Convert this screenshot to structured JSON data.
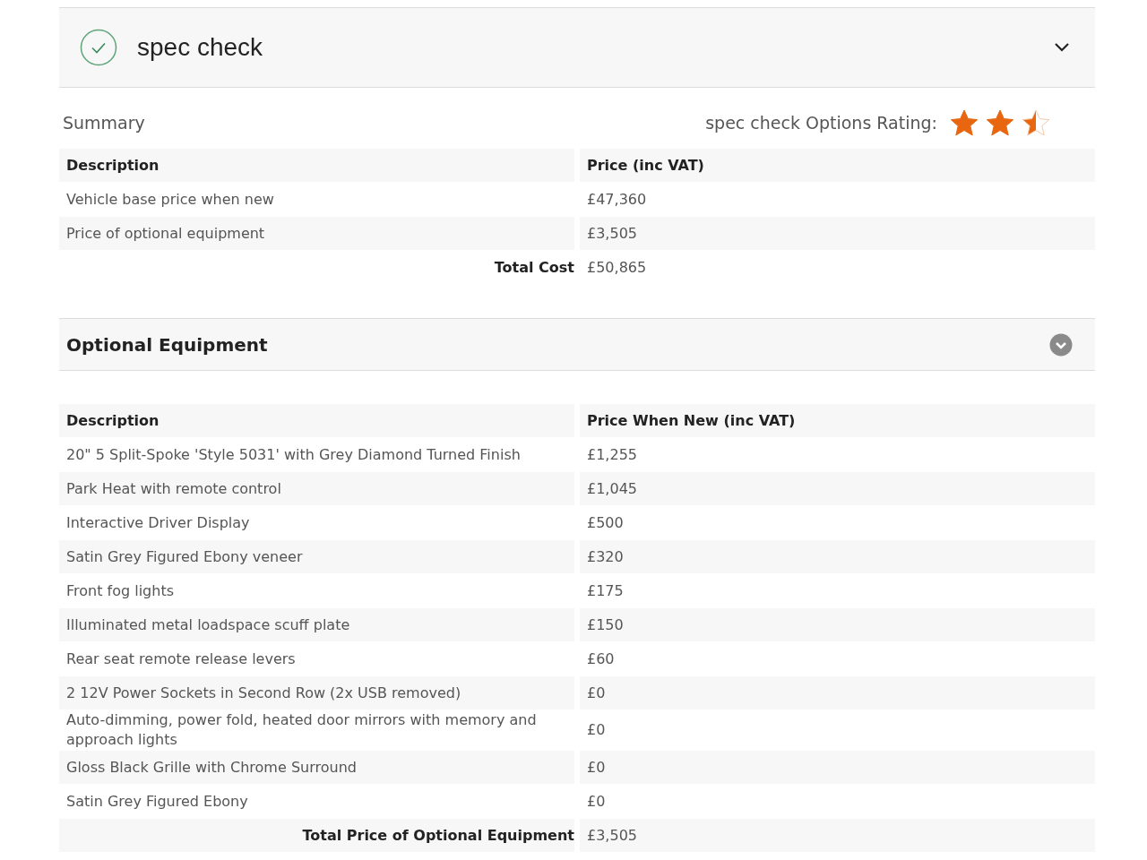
{
  "header": {
    "title": "spec check",
    "expanded": true
  },
  "summary": {
    "title": "Summary",
    "rating_label": "spec check Options Rating:",
    "stars": 2.5,
    "columns": [
      "Description",
      "Price (inc VAT)"
    ],
    "rows": [
      {
        "description": "Vehicle base price when new",
        "price": "£47,360"
      },
      {
        "description": "Price of optional equipment",
        "price": "£3,505"
      }
    ],
    "total": {
      "label": "Total Cost",
      "value": "£50,865"
    }
  },
  "optional_equipment": {
    "title": "Optional Equipment",
    "expanded": false,
    "columns": [
      "Description",
      "Price When New (inc VAT)"
    ],
    "rows": [
      {
        "description": "20\" 5 Split-Spoke 'Style 5031' with Grey Diamond Turned Finish",
        "price": "£1,255"
      },
      {
        "description": "Park Heat with remote control",
        "price": "£1,045"
      },
      {
        "description": "Interactive Driver Display",
        "price": "£500"
      },
      {
        "description": "Satin Grey Figured Ebony veneer",
        "price": "£320"
      },
      {
        "description": "Front fog lights",
        "price": "£175"
      },
      {
        "description": "Illuminated metal loadspace scuff plate",
        "price": "£150"
      },
      {
        "description": "Rear seat remote release levers",
        "price": "£60"
      },
      {
        "description": "2 12V Power Sockets in Second Row (2x USB removed)",
        "price": "£0"
      },
      {
        "description": "Auto-dimming, power fold, heated door mirrors with memory and approach lights",
        "price": "£0"
      },
      {
        "description": "Gloss Black Grille with Chrome Surround",
        "price": "£0"
      },
      {
        "description": "Satin Grey Figured Ebony",
        "price": "£0"
      }
    ],
    "total": {
      "label": "Total Price of Optional Equipment",
      "value": "£3,505"
    }
  }
}
